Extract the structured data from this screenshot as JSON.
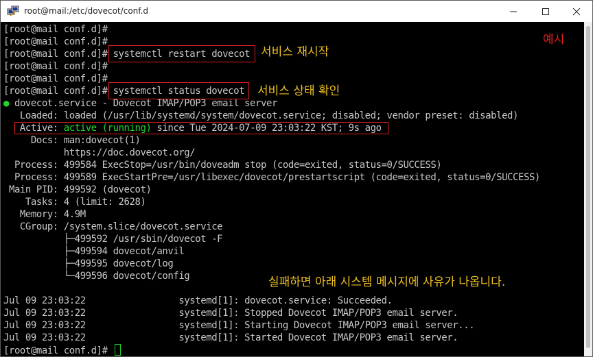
{
  "window": {
    "title": "root@mail:/etc/dovecot/conf.d",
    "icons": {
      "app": "putty-icon",
      "minimize": "minimize-icon",
      "maximize": "maximize-icon",
      "close": "close-icon"
    }
  },
  "terminal": {
    "lines": [
      "[root@mail conf.d]#",
      "[root@mail conf.d]#",
      "[root@mail conf.d]# systemctl restart dovecot",
      "[root@mail conf.d]#",
      "[root@mail conf.d]#",
      "[root@mail conf.d]# systemctl status dovecot"
    ],
    "status": {
      "dot": "●",
      "unit_line": " dovecot.service - Dovecot IMAP/POP3 email server",
      "loaded": "   Loaded: loaded (/usr/lib/systemd/system/dovecot.service; disabled; vendor preset: disabled)",
      "active_label": "   Active: ",
      "active_state": "active (running)",
      "active_rest": " since Tue 2024-07-09 23:03:22 KST; 9s ago",
      "docs1": "     Docs: man:dovecot(1)",
      "docs2": "           https://doc.dovecot.org/",
      "process1": "  Process: 499584 ExecStop=/usr/bin/doveadm stop (code=exited, status=0/SUCCESS)",
      "process2": "  Process: 499589 ExecStartPre=/usr/libexec/dovecot/prestartscript (code=exited, status=0/SUCCESS)",
      "main_pid": " Main PID: 499592 (dovecot)",
      "tasks": "    Tasks: 4 (limit: 2628)",
      "memory": "   Memory: 4.9M",
      "cgroup": "   CGroup: /system.slice/dovecot.service",
      "tree1": "           ├─499592 /usr/sbin/dovecot -F",
      "tree2": "           ├─499594 dovecot/anvil",
      "tree3": "           ├─499595 dovecot/log",
      "tree4": "           └─499596 dovecot/config"
    },
    "log": [
      "Jul 09 23:03:22                 systemd[1]: dovecot.service: Succeeded.",
      "Jul 09 23:03:22                 systemd[1]: Stopped Dovecot IMAP/POP3 email server.",
      "Jul 09 23:03:22                 systemd[1]: Starting Dovecot IMAP/POP3 email server...",
      "Jul 09 23:03:22                 systemd[1]: Started Dovecot IMAP/POP3 email server."
    ],
    "prompt_last": "[root@mail conf.d]#"
  },
  "annotations": {
    "example": "예시",
    "restart": "서비스 재시작",
    "status": "서비스 상태 확인",
    "failure": "실패하면 아래 시스템 메시지에 사유가 나옵니다."
  },
  "colors": {
    "highlight_box": "#e02020",
    "annotation": "#f0c020",
    "active_green": "#22d42b",
    "terminal_text": "#c8c8c8",
    "terminal_bg": "#000000"
  }
}
